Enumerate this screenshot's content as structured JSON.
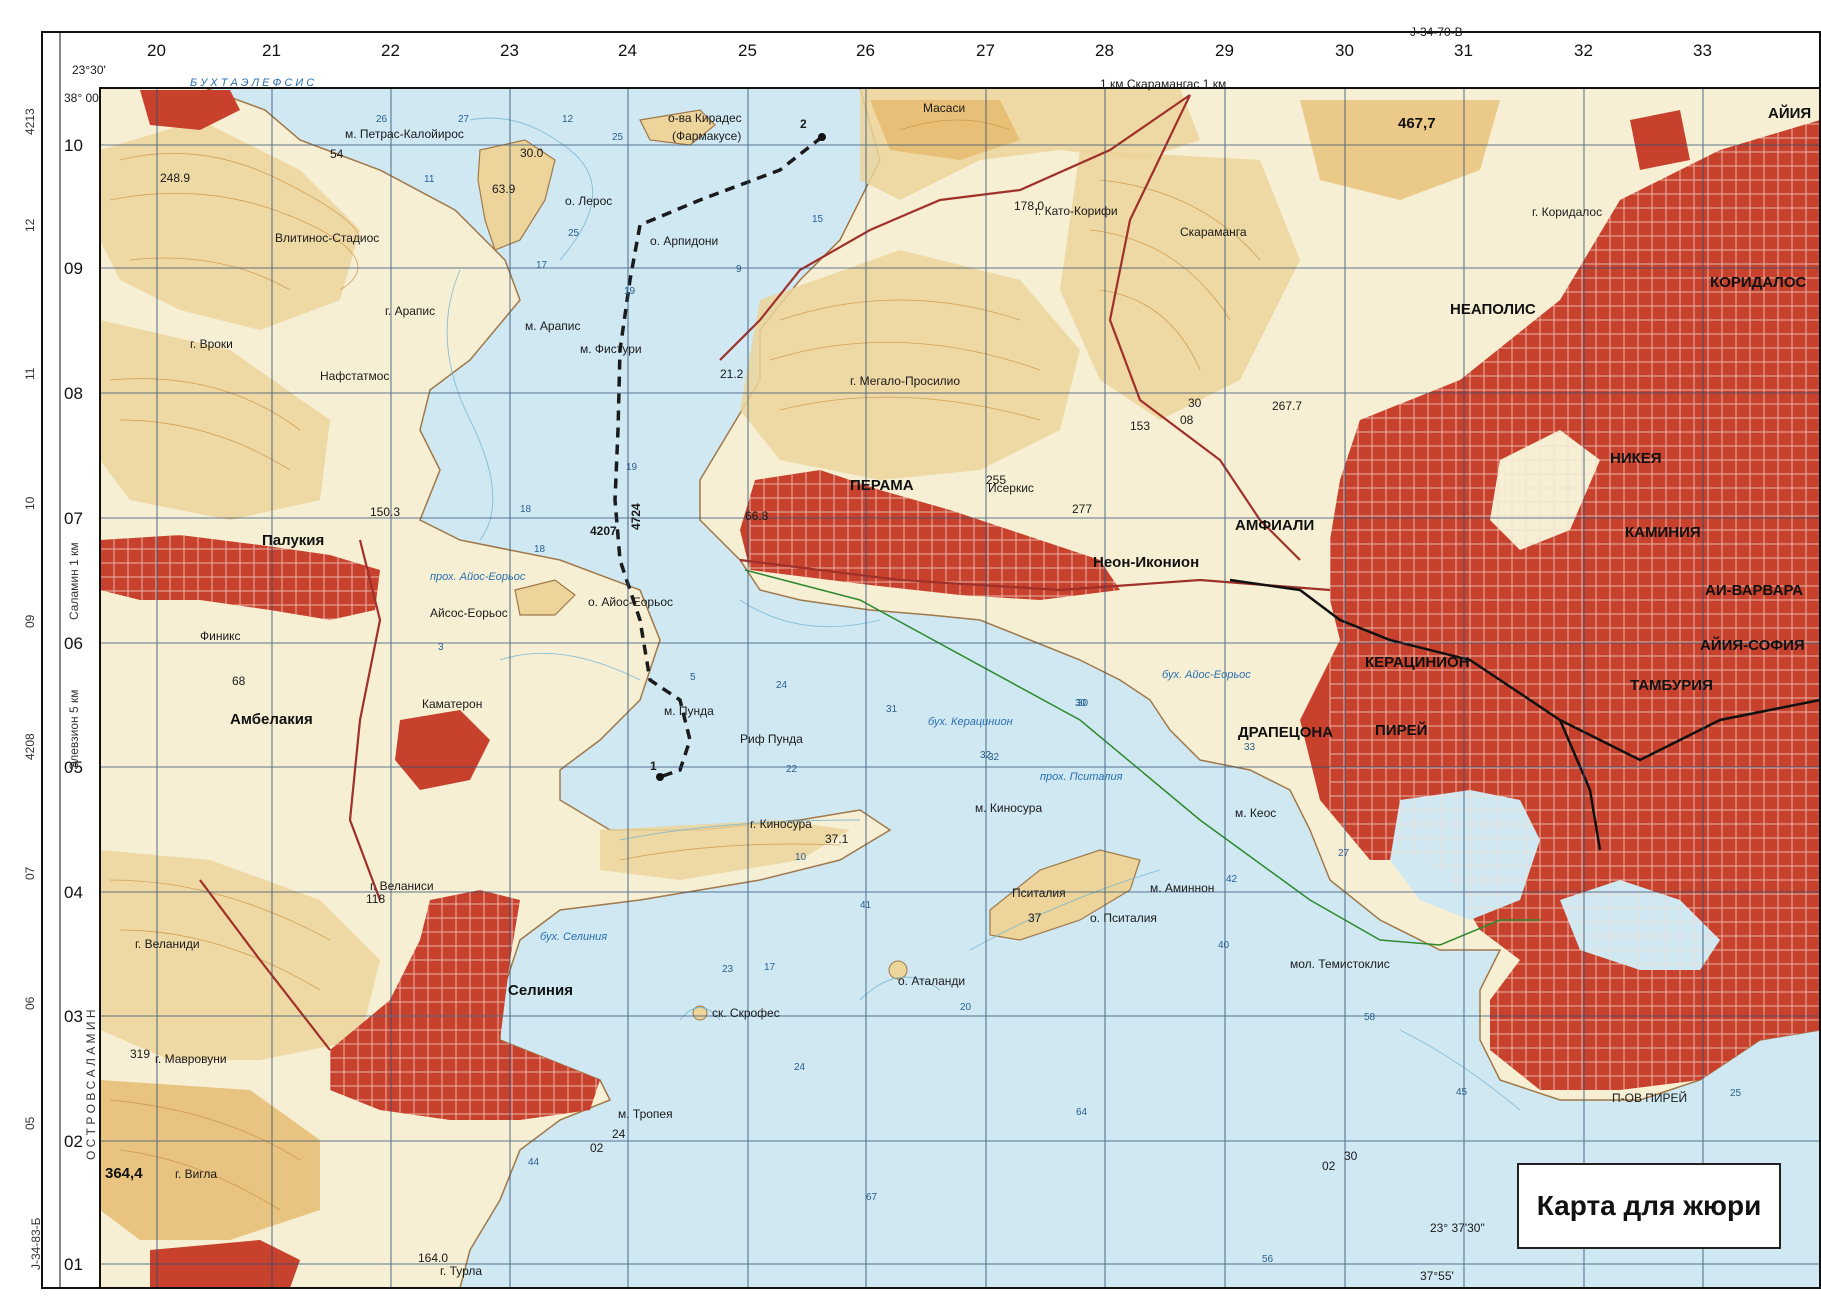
{
  "map": {
    "sheet_top": "J-34-70-В",
    "sheet_left": "J-34-83-Б",
    "corner_lon": "23°30'",
    "corner_lat": "38° 00'",
    "corner_bl_lon": "23° 37'30\"",
    "corner_bl_lat": "37°55'",
    "top_scale": "1 км Скарамангас 1 км",
    "left_scale": "Саламин 1 км",
    "left_scale2": "Элевзион 5 км",
    "bay_title": "Б У Х Т А   Э Л Е Ф С И С",
    "island_title": "О С Т Р О В   С А Л А М И Н",
    "grid_x": [
      "20",
      "21",
      "22",
      "23",
      "24",
      "25",
      "26",
      "27",
      "28",
      "29",
      "30",
      "31",
      "32",
      "33"
    ],
    "grid_y": [
      "10",
      "09",
      "08",
      "07",
      "06",
      "05",
      "04",
      "03",
      "02",
      "01"
    ],
    "grid_y_alt": [
      "4213",
      "12",
      "11",
      "10",
      "09",
      "4208",
      "07",
      "06",
      "05"
    ],
    "route_labels": [
      "1",
      "2",
      "4207",
      "4724"
    ],
    "coord_marks": [
      "02",
      "24",
      "02",
      "30",
      "30",
      "08"
    ]
  },
  "places": {
    "kiradhes": "о-ва Кирадес",
    "farmakuse": "(Фармакусе)",
    "petras": "м. Петрас-Калойирос",
    "leros": "о. Лерос",
    "arpidoni": "о. Арпидони",
    "vlitinos": "Влитинос-Стадиос",
    "arapis": "м. Арапис",
    "arapis2": "г. Арапис",
    "vroki": "г. Вроки",
    "naftstatmos": "Нафстатмос",
    "fistoyri": "м. Фистури",
    "palukia": "Палукия",
    "finiks": "Финикс",
    "aisos_eorios": "Айсос-Еорьос",
    "aios_eorios": "о. Айос-Еорьос",
    "ambelakia": "Амбелакия",
    "kamateron": "Каматерон",
    "punda": "м. Пунда",
    "rif_punda": "Риф Пунда",
    "kinosura_g": "г. Киносура",
    "kinosura_m": "м. Киносура",
    "velanisi": "г. Веланиси",
    "velanidi": "г. Веланиди",
    "selinia": "Селиния",
    "mavrovuni": "г. Мавровуни",
    "vigla": "г. Вигла",
    "vigla_h": "364,4",
    "tropea": "м. Тропея",
    "turla": "г. Турла",
    "psitalia": "Пситалия",
    "o_psitalia": "о. Пситалия",
    "aminnon": "м. Аминнон",
    "atalandi": "о. Аталанди",
    "skrofes": "ск. Скрофес",
    "perama": "ПЕРАМА",
    "megalo": "г. Мегало-Просилио",
    "iserkis": "Исеркис",
    "neon_ikonion": "Неон-Иконион",
    "amfiali": "АМФИАЛИ",
    "keratsinion": "КЕРАЦИНИОН",
    "drapetsona": "ДРАПЕЦОНА",
    "pirey": "ПИРЕЙ",
    "nikea": "НИКЕЯ",
    "neapolis": "НЕАПОЛИС",
    "koridalos": "КОРИДАЛОС",
    "koridalos_g": "г. Коридалос",
    "aiya": "АЙИЯ",
    "ag_varvara": "АИ-ВАРВАРА",
    "kaminia": "КАМИНИЯ",
    "ag_sofia": "АЙИЯ-СОФИЯ",
    "tamburia": "ТАМБУРИЯ",
    "keos": "м. Кеос",
    "temistoklis": "мол. Темистоклис",
    "p_ov_pirey": "П-ОВ ПИРЕЙ",
    "masasi": "Масаси",
    "kato_korifi": "г. Като-Корифи",
    "skaramanga": "Скараманга",
    "peak_467": "467,7",
    "keratsinion_bay": "бух. Керацинион",
    "ag_georgios_bay": "бух. Айос-Еорьос",
    "selinia_bay": "бух. Селиния",
    "psitalia_channel": "прох. Пситалия",
    "eorios_channel": "прох. Айос-Еорьос",
    "heights": [
      "54",
      "248.9",
      "63.9",
      "30.0",
      "150.3",
      "21.2",
      "66.8",
      "255",
      "277",
      "178.0",
      "153",
      "267.7",
      "68",
      "37.1",
      "118",
      "319",
      "164.0",
      "37"
    ]
  },
  "depths": [
    "26",
    "27",
    "12",
    "25",
    "15",
    "11",
    "25",
    "17",
    "19",
    "9",
    "18",
    "18",
    "19",
    "3",
    "5",
    "24",
    "31",
    "22",
    "32",
    "41",
    "23",
    "17",
    "24",
    "64",
    "30",
    "32",
    "33",
    "27",
    "42",
    "40",
    "58",
    "45",
    "25",
    "44",
    "67",
    "56",
    "30",
    "20",
    "10"
  ],
  "legend": {
    "label": "Карта для жюри"
  },
  "colors": {
    "sea": "#cfe8f2",
    "land": "#f6efd4",
    "hill": "#ecd49a",
    "hill_dark": "#e5b96a",
    "urban": "#c8412c",
    "contour": "#c48a3a",
    "grid": "#2f4f74",
    "route": "#1b1b1b",
    "green_line": "#2d8a2d"
  }
}
